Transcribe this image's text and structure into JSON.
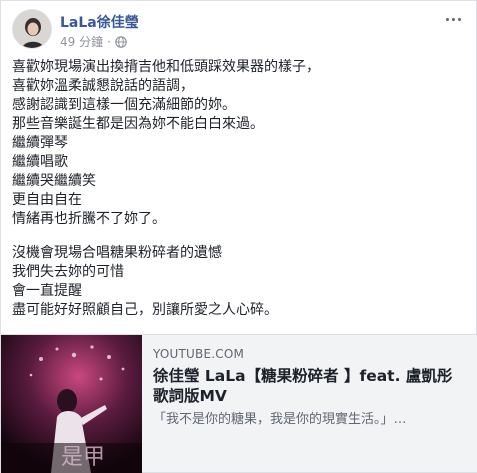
{
  "post": {
    "author": "LaLa徐佳瑩",
    "time": "49 分鐘",
    "separator": "·",
    "privacy_icon": "globe-icon",
    "more_icon": "more-options-icon"
  },
  "content": {
    "paragraphs": [
      [
        "喜歡妳現場演出換揹吉他和低頭踩效果器的樣子，",
        "喜歡妳溫柔誠懇說話的語調，",
        "感謝認識到這樣一個充滿細節的妳。",
        "那些音樂誕生都是因為妳不能白白來過。",
        "繼續彈琴",
        "繼續唱歌",
        "繼續哭繼續笑",
        "更自由自在",
        "情緒再也折騰不了妳了。"
      ],
      [
        "沒機會現場合唱糖果粉碎者的遺憾",
        "我們失去妳的可惜",
        "會一直提醒",
        "盡可能好好照顧自己，別讓所愛之人心碎。"
      ]
    ]
  },
  "link_preview": {
    "domain": "YOUTUBE.COM",
    "title": "徐佳瑩 LaLa【糖果粉碎者 】feat. 盧凱彤 歌詞版MV",
    "description": "「我不是你的糖果，我是你的現實生活。」…",
    "thumbnail_caption": "是甲"
  },
  "colors": {
    "author": "#385898",
    "text": "#1d2129",
    "muted": "#90949c",
    "link_bg": "#f2f3f5"
  }
}
